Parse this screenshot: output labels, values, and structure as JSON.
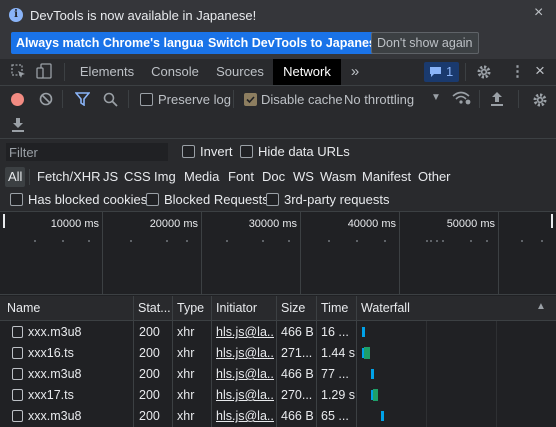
{
  "infobar": {
    "message": "DevTools is now available in Japanese!",
    "buttons": [
      "Always match Chrome's language",
      "Switch DevTools to Japanese",
      "Don't show again"
    ]
  },
  "tabs": [
    "Elements",
    "Console",
    "Sources",
    "Network"
  ],
  "active_tab": "Network",
  "issues_count": "1",
  "toolbar": {
    "preserve_log": "Preserve log",
    "disable_cache": "Disable cache",
    "throttling": "No throttling"
  },
  "filter": {
    "placeholder": "Filter",
    "invert": "Invert",
    "hide_data_urls": "Hide data URLs",
    "types": [
      "All",
      "Fetch/XHR",
      "JS",
      "CSS",
      "Img",
      "Media",
      "Font",
      "Doc",
      "WS",
      "Wasm",
      "Manifest",
      "Other"
    ],
    "active_type": "All",
    "blocked_cookies": "Has blocked cookies",
    "blocked_requests": "Blocked Requests",
    "third_party": "3rd-party requests"
  },
  "overview_ticks": [
    "10000 ms",
    "20000 ms",
    "30000 ms",
    "40000 ms",
    "50000 ms"
  ],
  "columns": [
    "Name",
    "Stat...",
    "Type",
    "Initiator",
    "Size",
    "Time",
    "Waterfall"
  ],
  "rows": [
    {
      "name": "xxx.m3u8",
      "status": "200",
      "type": "xhr",
      "initiator": "hls.js@la...",
      "size": "466 B",
      "time": "16 ..."
    },
    {
      "name": "xxx16.ts",
      "status": "200",
      "type": "xhr",
      "initiator": "hls.js@la...",
      "size": "271...",
      "time": "1.44 s"
    },
    {
      "name": "xxx.m3u8",
      "status": "200",
      "type": "xhr",
      "initiator": "hls.js@la...",
      "size": "466 B",
      "time": "77 ..."
    },
    {
      "name": "xxx17.ts",
      "status": "200",
      "type": "xhr",
      "initiator": "hls.js@la...",
      "size": "270...",
      "time": "1.29 s"
    },
    {
      "name": "xxx.m3u8",
      "status": "200",
      "type": "xhr",
      "initiator": "hls.js@la...",
      "size": "466 B",
      "time": "65 ..."
    }
  ],
  "colors": {
    "accent": "#1a73e8",
    "record": "#f28b82",
    "waiting": "#00a2e8",
    "download": "#1e9f69"
  }
}
